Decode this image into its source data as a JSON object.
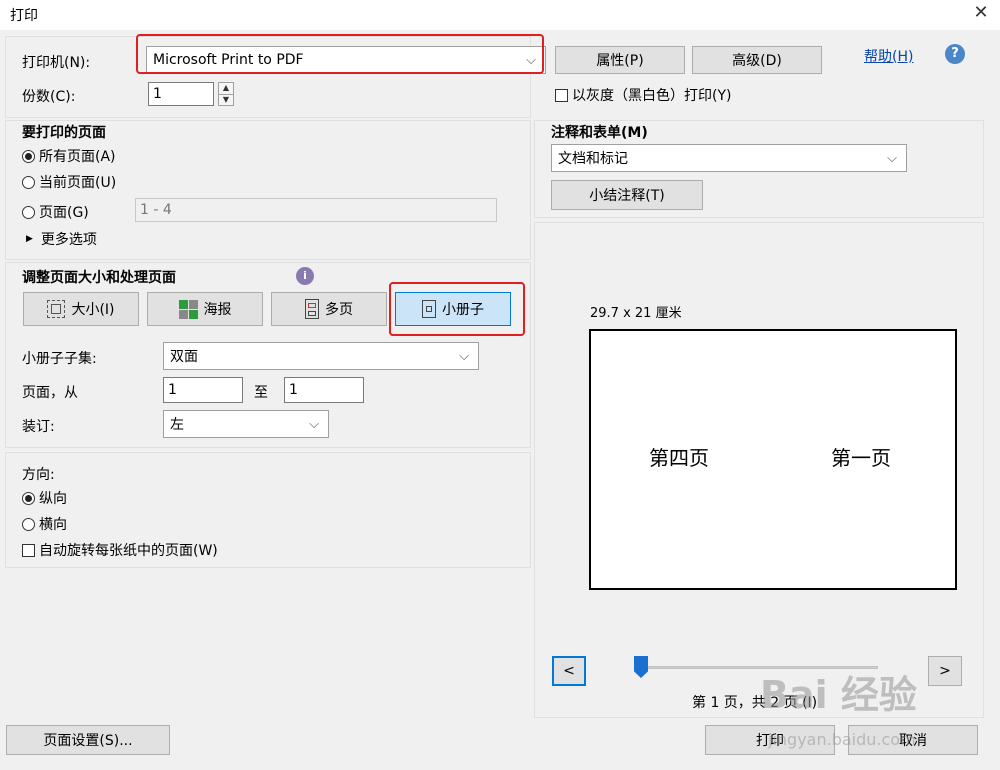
{
  "window": {
    "title": "打印",
    "close_glyph": "✕"
  },
  "printer": {
    "label": "打印机(N):",
    "selected": "Microsoft Print to PDF",
    "properties_button": "属性(P)",
    "advanced_button": "高级(D)",
    "help_link": "帮助(H)",
    "help_icon_glyph": "?"
  },
  "copies": {
    "label": "份数(C):",
    "value": "1"
  },
  "grayscale": {
    "label": "以灰度（黑白色）打印(Y)",
    "checked": false
  },
  "pages_to_print": {
    "heading": "要打印的页面",
    "all_pages": "所有页面(A)",
    "current_page": "当前页面(U)",
    "pages": "页面(G)",
    "pages_range": "1 - 4",
    "more_options": "更多选项",
    "more_options_glyph": "▶"
  },
  "sizing": {
    "heading": "调整页面大小和处理页面",
    "info_glyph": "i",
    "tabs": [
      {
        "label": "大小(I)"
      },
      {
        "label": "海报"
      },
      {
        "label": "多页"
      },
      {
        "label": "小册子"
      }
    ],
    "booklet_subset_label": "小册子子集:",
    "booklet_subset_value": "双面",
    "pages_from_label": "页面，从",
    "pages_from_value": "1",
    "to_label": "至",
    "pages_to_value": "1",
    "binding_label": "装订:",
    "binding_value": "左"
  },
  "orientation": {
    "heading": "方向:",
    "portrait": "纵向",
    "landscape": "横向",
    "auto_rotate": "自动旋转每张纸中的页面(W)"
  },
  "comments": {
    "heading": "注释和表单(M)",
    "selected": "文档和标记",
    "summarize_button": "小结注释(T)"
  },
  "preview": {
    "paper_size": "29.7 x 21 厘米",
    "left_page": "第四页",
    "right_page": "第一页",
    "prev_glyph": "<",
    "next_glyph": ">",
    "page_counter": "第 1 页，共 2 页 (I)",
    "slider_position": 0
  },
  "footer": {
    "page_setup_button": "页面设置(S)...",
    "print_button": "打印",
    "cancel_button": "取消"
  },
  "watermark": {
    "brand": "Bai 经验",
    "url": "jingyan.baidu.com"
  },
  "colors": {
    "accent_red": "#e02020",
    "active_tab": "#cce4f7",
    "link": "#0645ad"
  }
}
